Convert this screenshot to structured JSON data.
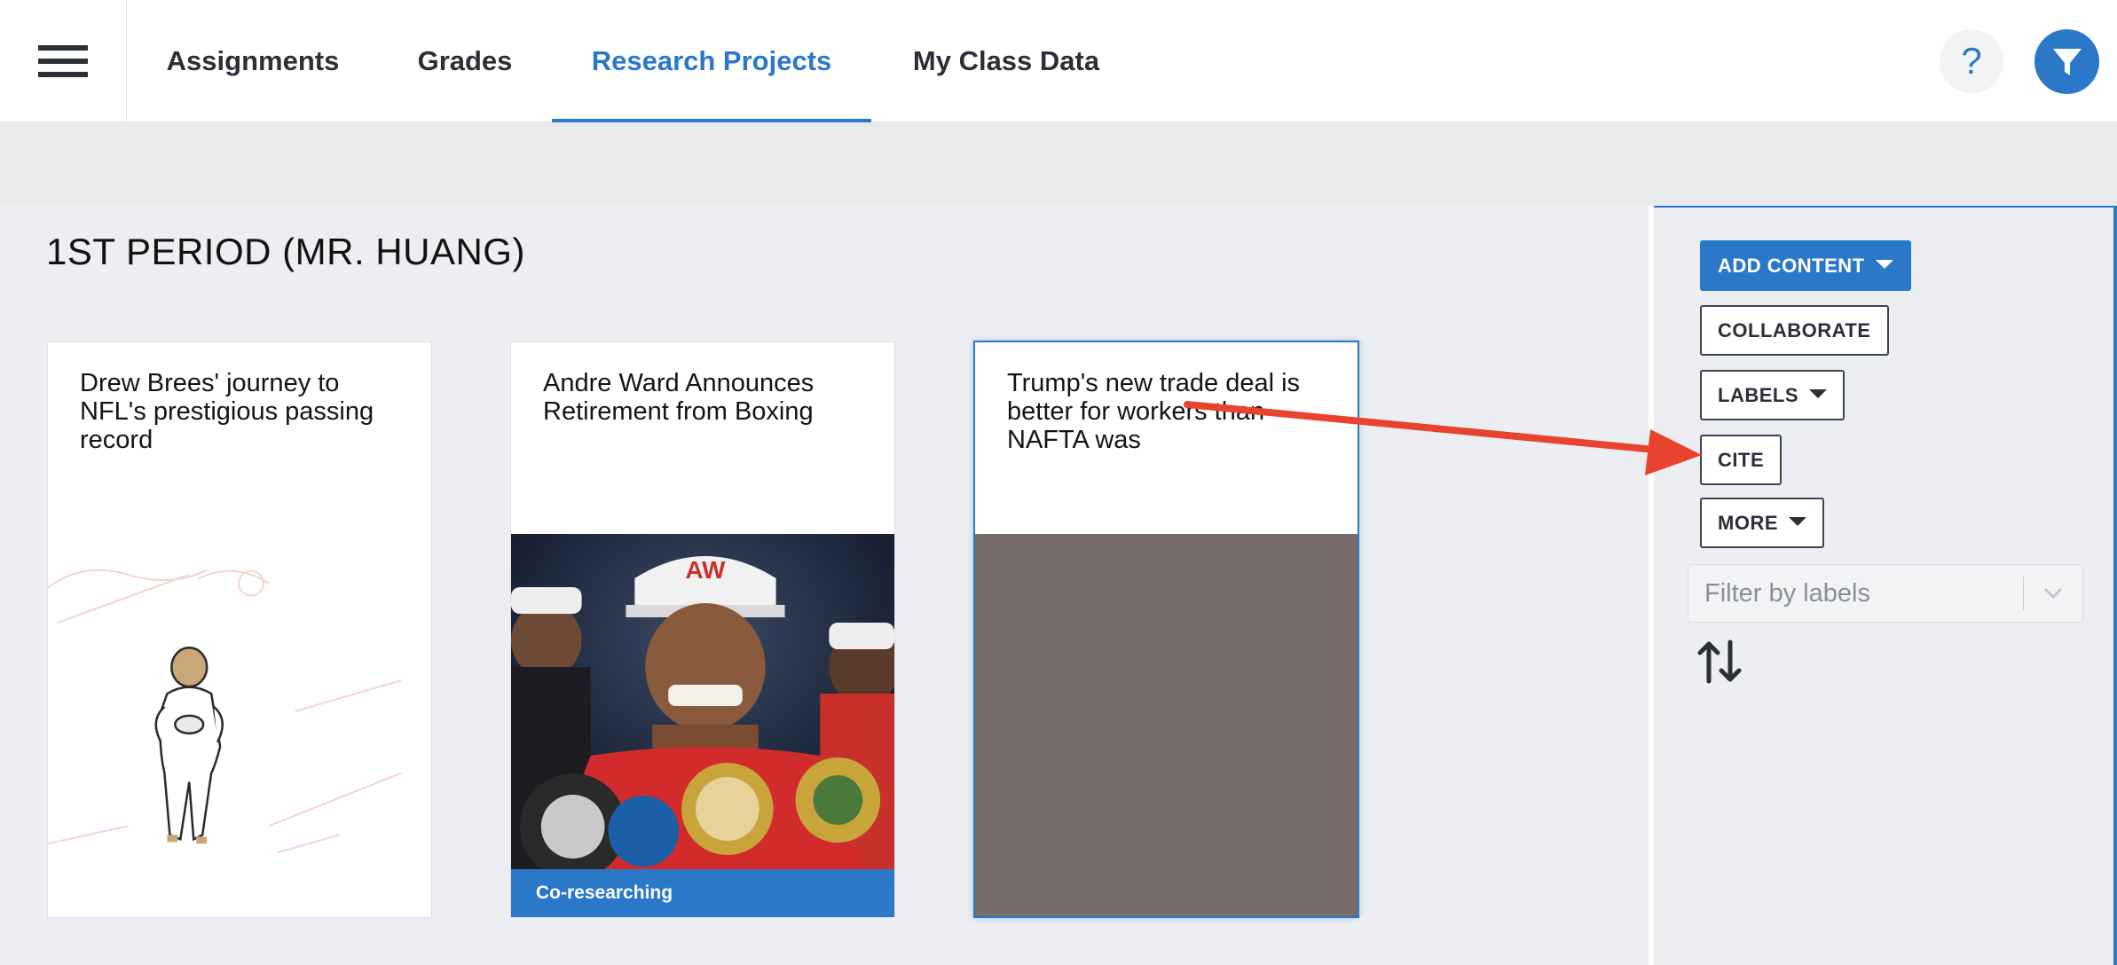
{
  "nav": {
    "tabs": [
      {
        "label": "Assignments"
      },
      {
        "label": "Grades"
      },
      {
        "label": "Research Projects"
      },
      {
        "label": "My Class Data"
      }
    ],
    "help_label": "?"
  },
  "page": {
    "title": "1ST PERIOD (MR. HUANG)"
  },
  "cards": [
    {
      "title": "Drew Brees' journey to NFL's prestigious passing record"
    },
    {
      "title": "Andre Ward Announces Retirement from Boxing",
      "badge": "Co-researching"
    },
    {
      "title": "Trump's new trade deal is better for workers than NAFTA was"
    }
  ],
  "sidebar": {
    "add_content": "ADD CONTENT",
    "collaborate": "COLLABORATE",
    "labels": "LABELS",
    "cite": "CITE",
    "more": "MORE",
    "filter_placeholder": "Filter by labels"
  },
  "colors": {
    "accent": "#2b78c9",
    "annotation_arrow": "#e8432f",
    "card_placeholder": "#786d6a"
  }
}
